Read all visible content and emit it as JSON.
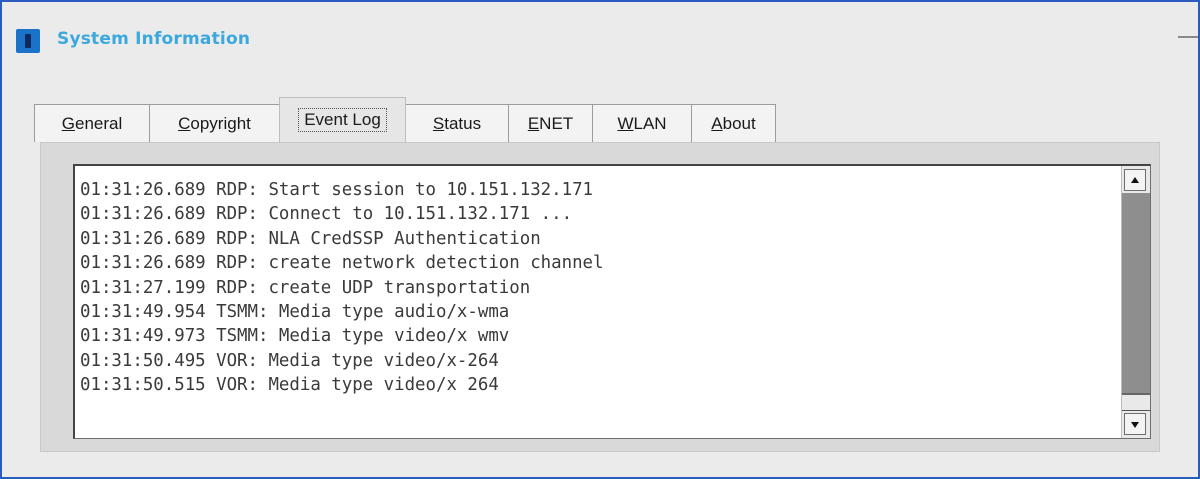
{
  "window": {
    "title": "System Information",
    "icon": "info-icon",
    "minimize_icon": "minimize-icon"
  },
  "tabs": [
    {
      "pre": "",
      "mnemonic": "G",
      "post": "eneral"
    },
    {
      "pre": "",
      "mnemonic": "C",
      "post": "opyright"
    },
    {
      "pre": "Event Lo",
      "mnemonic": "g",
      "post": ""
    },
    {
      "pre": "",
      "mnemonic": "S",
      "post": "tatus"
    },
    {
      "pre": "",
      "mnemonic": "E",
      "post": "NET"
    },
    {
      "pre": "",
      "mnemonic": "W",
      "post": "LAN"
    },
    {
      "pre": "",
      "mnemonic": "A",
      "post": "bout"
    }
  ],
  "active_tab_index": 2,
  "event_log": {
    "lines": [
      "01:31:26.689 RDP: Start session to 10.151.132.171",
      "01:31:26.689 RDP: Connect to 10.151.132.171 ...",
      "01:31:26.689 RDP: NLA CredSSP Authentication",
      "01:31:26.689 RDP: create network detection channel",
      "01:31:27.199 RDP: create UDP transportation",
      "01:31:49.954 TSMM: Media type audio/x-wma",
      "01:31:49.973 TSMM: Media type video/x wmv",
      "01:31:50.495 VOR: Media type video/x-264",
      "01:31:50.515 VOR: Media type video/x 264"
    ]
  },
  "scrollbar": {
    "up_icon": "arrow-up-icon",
    "down_icon": "arrow-down-icon"
  },
  "colors": {
    "window_border": "#2a5bbf",
    "title_text": "#3ca8dd",
    "app_icon": "#1a73c9"
  }
}
